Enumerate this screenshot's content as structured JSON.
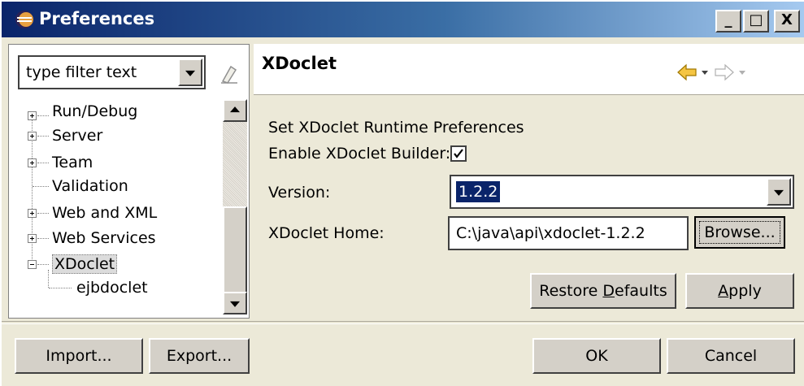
{
  "window": {
    "title": "Preferences",
    "minimize": "_",
    "maximize": "□",
    "close": "X"
  },
  "left_panel": {
    "filter_text": "type filter text",
    "tree": [
      {
        "label": "Run/Debug",
        "expander": "plus"
      },
      {
        "label": "Server",
        "expander": "plus"
      },
      {
        "label": "Team",
        "expander": "plus"
      },
      {
        "label": "Validation",
        "expander": "none"
      },
      {
        "label": "Web and XML",
        "expander": "plus"
      },
      {
        "label": "Web Services",
        "expander": "plus"
      },
      {
        "label": "XDoclet",
        "expander": "minus",
        "selected": true
      },
      {
        "label": "ejbdoclet",
        "expander": "child"
      }
    ]
  },
  "page": {
    "title": "XDoclet",
    "description": "Set XDoclet Runtime Preferences",
    "enable_label": "Enable XDoclet Builder:",
    "enable_checked": true,
    "version_label": "Version:",
    "version_value": "1.2.2",
    "home_label": "XDoclet Home:",
    "home_value": "C:\\java\\api\\xdoclet-1.2.2",
    "browse_label": "Browse...",
    "restore_prefix": "Restore ",
    "restore_mnemonic": "D",
    "restore_suffix": "efaults",
    "apply_mnemonic": "A",
    "apply_suffix": "pply"
  },
  "footer": {
    "import_label": "Import...",
    "export_label": "Export...",
    "ok_label": "OK",
    "cancel_label": "Cancel"
  },
  "icons": {
    "window": "eclipse-icon",
    "clear_filter": "eraser-icon",
    "back": "back-arrow-icon",
    "forward": "forward-arrow-icon"
  },
  "colors": {
    "titlebar": "#0a246a",
    "selection": "#0a246a",
    "dialog_bg": "#ece9d8",
    "nav_arrow": "#f5c542"
  }
}
